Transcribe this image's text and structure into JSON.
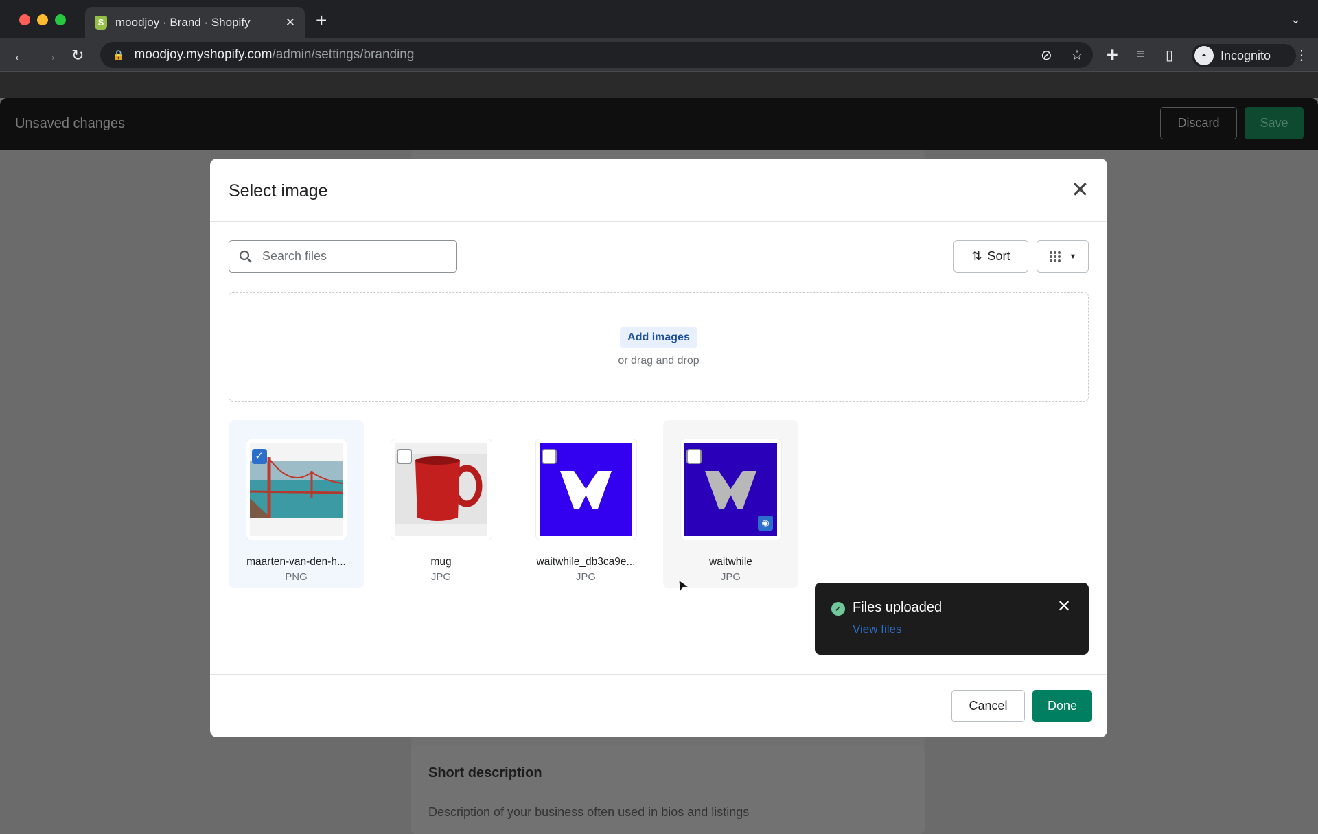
{
  "browser": {
    "tab_title": "moodjoy · Brand · Shopify",
    "url_host": "moodjoy.myshopify.com",
    "url_path": "/admin/settings/branding",
    "profile": "Incognito"
  },
  "colors": {
    "accent": "#008060",
    "selected": "#2c6ecb",
    "toast_bg": "#1c1c1c"
  },
  "unsaved_bar": {
    "label": "Unsaved changes",
    "discard": "Discard",
    "save": "Save"
  },
  "background_page": {
    "section_title": "Short description",
    "section_desc": "Description of your business often used in bios and listings"
  },
  "modal": {
    "title": "Select image",
    "search_placeholder": "Search files",
    "sort_label": "Sort",
    "dropzone": {
      "button": "Add images",
      "hint": "or drag and drop"
    },
    "files": [
      {
        "name": "maarten-van-den-h...",
        "type": "PNG",
        "selected": true
      },
      {
        "name": "mug",
        "type": "JPG",
        "selected": false
      },
      {
        "name": "waitwhile_db3ca9e...",
        "type": "JPG",
        "selected": false
      },
      {
        "name": "waitwhile",
        "type": "JPG",
        "selected": false
      }
    ],
    "toast": {
      "title": "Files uploaded",
      "link": "View files"
    },
    "cancel": "Cancel",
    "done": "Done"
  }
}
